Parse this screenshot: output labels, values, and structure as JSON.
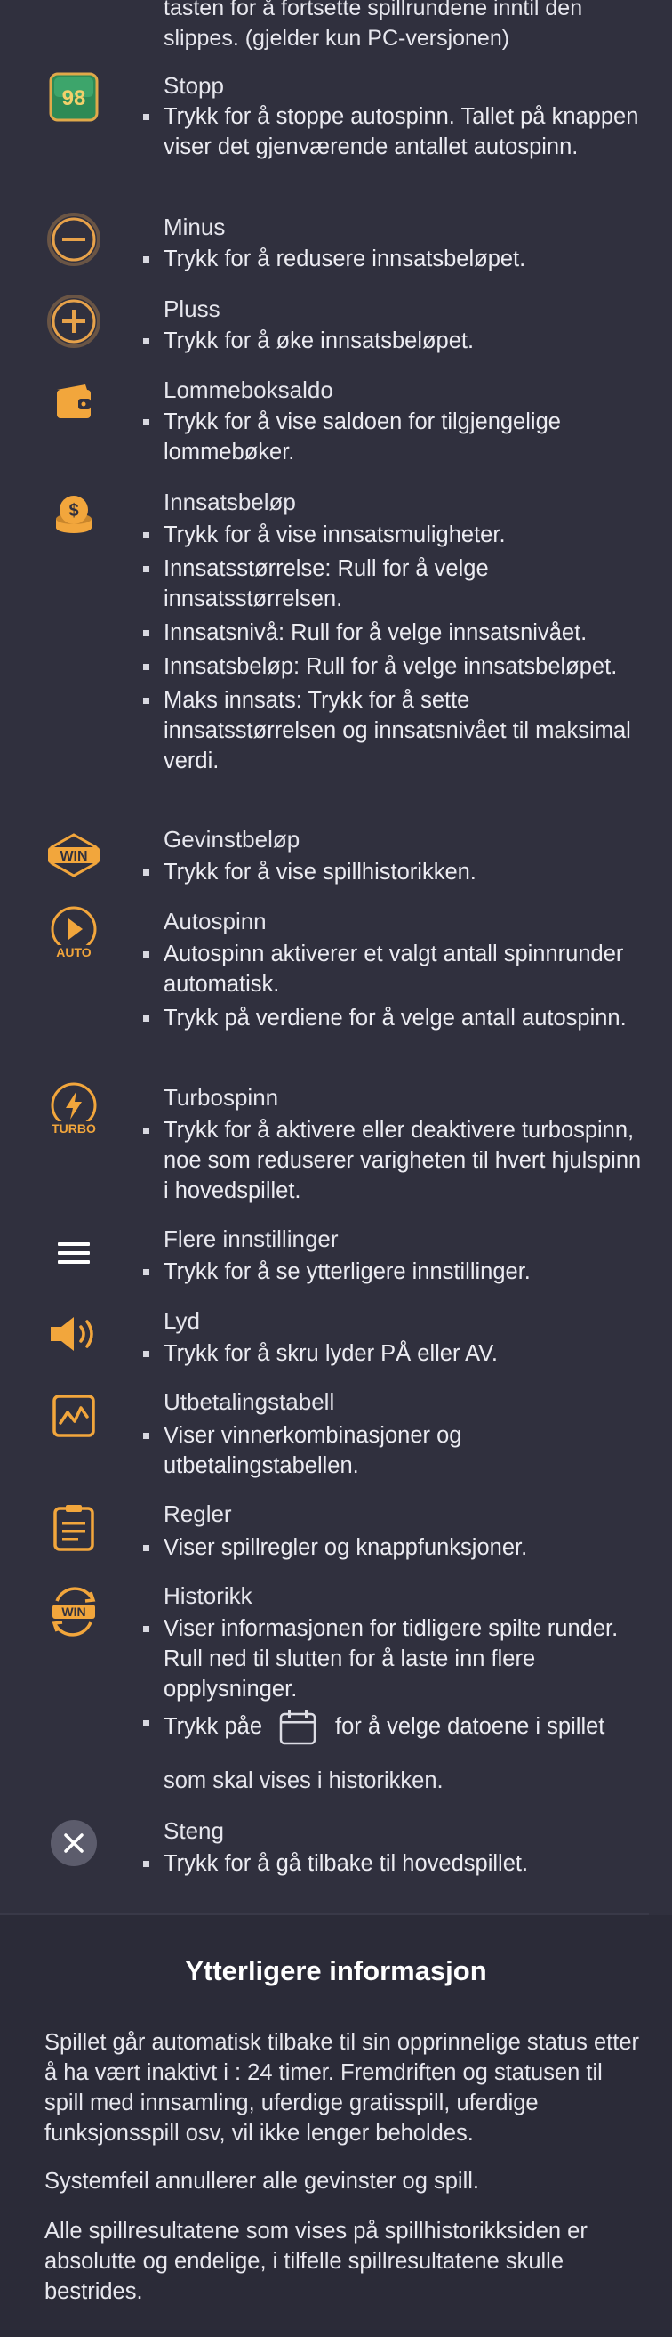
{
  "top_text": "tasten for å fortsette spillrundene inntil den slippes. (gjelder kun PC-versjonen)",
  "items": [
    {
      "title": "Stopp",
      "icon": "stop-98-icon",
      "icon_text": "98",
      "bullets": [
        "Trykk for å stoppe autospinn. Tallet på knappen viser det gjenværende antallet autospinn."
      ]
    },
    {
      "title": "Minus",
      "icon": "minus-icon",
      "bullets": [
        "Trykk for å redusere innsatsbeløpet."
      ]
    },
    {
      "title": "Pluss",
      "icon": "plus-icon",
      "bullets": [
        "Trykk for å øke innsatsbeløpet."
      ]
    },
    {
      "title": "Lommeboksaldo",
      "icon": "wallet-icon",
      "bullets": [
        "Trykk for å vise saldoen for tilgjengelige lommebøker."
      ]
    },
    {
      "title": "Innsatsbeløp",
      "icon": "coins-icon",
      "bullets": [
        "Trykk for å vise innsatsmuligheter.",
        "Innsatsstørrelse: Rull for å velge innsatsstørrelsen.",
        "Innsatsnivå: Rull for å velge innsatsnivået.",
        "Innsatsbeløp: Rull for å velge innsatsbeløpet.",
        "Maks innsats: Trykk for å sette innsatsstørrelsen og innsatsnivået til maksimal verdi."
      ]
    },
    {
      "title": "Gevinstbeløp",
      "icon": "win-icon",
      "icon_text": "WIN",
      "bullets": [
        "Trykk for å vise spillhistorikken."
      ]
    },
    {
      "title": "Autospinn",
      "icon": "autospin-icon",
      "icon_text": "AUTO",
      "bullets": [
        "Autospinn aktiverer et valgt antall spinnrunder automatisk.",
        "Trykk på verdiene for å velge antall autospinn."
      ]
    },
    {
      "title": "Turbospinn",
      "icon": "turbo-icon",
      "icon_text": "TURBO",
      "bullets": [
        "Trykk for å aktivere eller deaktivere turbospinn, noe som reduserer varigheten til hvert hjulspinn i hovedspillet."
      ]
    },
    {
      "title": "Flere innstillinger",
      "icon": "menu-icon",
      "bullets": [
        "Trykk for å se ytterligere innstillinger."
      ]
    },
    {
      "title": "Lyd",
      "icon": "sound-icon",
      "bullets": [
        "Trykk for å skru lyder PÅ eller AV."
      ]
    },
    {
      "title": "Utbetalingstabell",
      "icon": "paytable-icon",
      "bullets": [
        "Viser vinnerkombinasjoner og utbetalingstabellen."
      ]
    },
    {
      "title": "Regler",
      "icon": "rules-icon",
      "bullets": [
        "Viser spillregler og knappfunksjoner."
      ]
    },
    {
      "title": "Historikk",
      "icon": "history-icon",
      "icon_text": "WIN",
      "bullets": [
        "Viser informasjonen for tidligere spilte runder. Rull ned til slutten for å laste inn flere opplysninger."
      ],
      "calendar_pre": "Trykk påe",
      "calendar_post": "for å velge datoene i spillet",
      "calendar_line2": "som skal vises i historikken."
    },
    {
      "title": "Steng",
      "icon": "close-icon",
      "bullets": [
        "Trykk for å gå tilbake til hovedspillet."
      ]
    }
  ],
  "more_info": {
    "title": "Ytterligere informasjon",
    "paragraphs": [
      "Spillet går automatisk tilbake til sin opprinnelige status etter å ha vært inaktivt i : 24 timer. Fremdriften og statusen til spill med innsamling, uferdige gratisspill, uferdige funksjonsspill osv, vil ikke lenger beholdes.",
      "Systemfeil annullerer alle gevinster og spill.",
      "Alle spillresultatene som vises på spillhistorikksiden er absolutte og endelige, i tilfelle spillresultatene skulle bestrides."
    ]
  },
  "colors": {
    "accent": "#f2a63c",
    "background": "#30303e",
    "text": "#e7e7ee"
  }
}
